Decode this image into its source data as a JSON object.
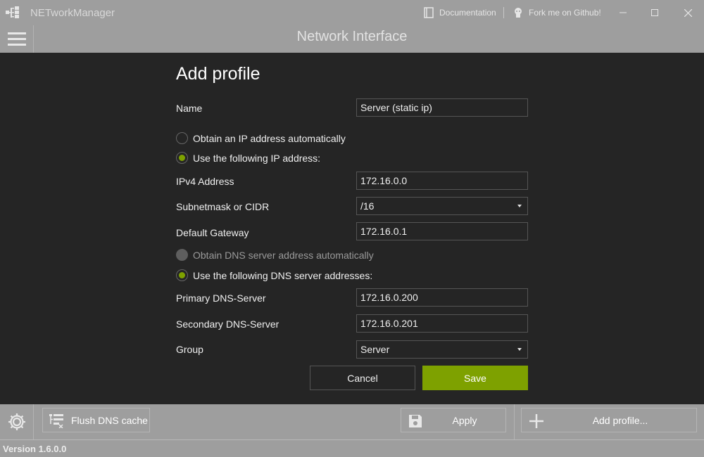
{
  "titlebar": {
    "app_title": "NETworkManager",
    "documentation_label": "Documentation",
    "github_label": "Fork me on Github!",
    "logo_icon": "network-tree-icon",
    "documentation_icon": "book-icon",
    "github_icon": "octocat-icon"
  },
  "header": {
    "title": "Network Interface",
    "menu_icon": "hamburger-menu-icon"
  },
  "dialog": {
    "title": "Add profile",
    "name_label": "Name",
    "name_value": "Server (static ip)",
    "ip_auto_label": "Obtain an IP address automatically",
    "ip_static_label": "Use the following IP address:",
    "ipv4_label": "IPv4 Address",
    "ipv4_value": "172.16.0.0",
    "subnet_label": "Subnetmask or CIDR",
    "subnet_value": "/16",
    "gateway_label": "Default Gateway",
    "gateway_value": "172.16.0.1",
    "dns_auto_label": "Obtain DNS server address automatically",
    "dns_static_label": "Use the following DNS server addresses:",
    "primary_dns_label": "Primary DNS-Server",
    "primary_dns_value": "172.16.0.200",
    "secondary_dns_label": "Secondary DNS-Server",
    "secondary_dns_value": "172.16.0.201",
    "group_label": "Group",
    "group_value": "Server",
    "cancel_label": "Cancel",
    "save_label": "Save"
  },
  "footer": {
    "flush_dns_label": "Flush DNS cache",
    "apply_label": "Apply",
    "add_profile_label": "Add profile...",
    "settings_icon": "gear-icon"
  },
  "status": {
    "version": "Version 1.6.0.0"
  },
  "colors": {
    "accent": "#7ea100",
    "chrome": "#9e9e9e",
    "panel": "#252525"
  }
}
